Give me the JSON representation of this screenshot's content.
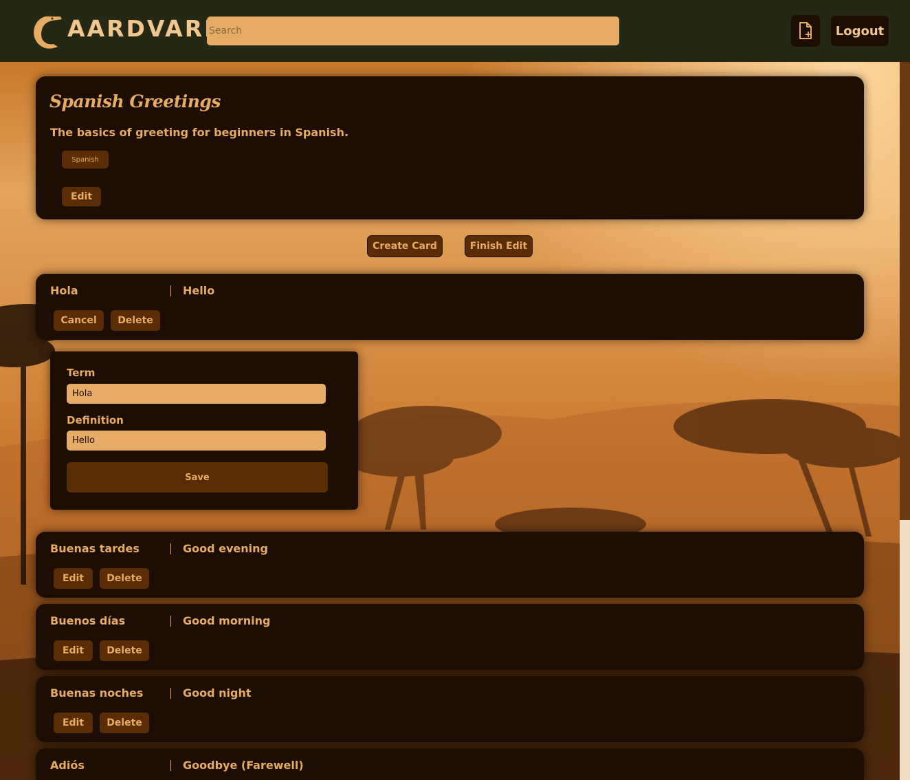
{
  "header": {
    "brand": "AARDVARK",
    "search_placeholder": "Search",
    "new_deck_icon": "file-plus-icon",
    "logout_label": "Logout"
  },
  "deck": {
    "title": "Spanish Greetings",
    "description": "The basics of greeting for beginners in Spanish.",
    "tag": "Spanish",
    "edit_label": "Edit"
  },
  "actions": {
    "create_card": "Create Card",
    "finish_edit": "Finish Edit"
  },
  "editing_card": {
    "term": "Hola",
    "definition": "Hello",
    "cancel_label": "Cancel",
    "delete_label": "Delete"
  },
  "editor": {
    "term_label": "Term",
    "term_value": "Hola",
    "definition_label": "Definition",
    "definition_value": "Hello",
    "save_label": "Save"
  },
  "cards": [
    {
      "term": "Buenas tardes",
      "definition": "Good evening",
      "edit_label": "Edit",
      "delete_label": "Delete"
    },
    {
      "term": "Buenos días",
      "definition": "Good morning",
      "edit_label": "Edit",
      "delete_label": "Delete"
    },
    {
      "term": "Buenas noches",
      "definition": "Good night",
      "edit_label": "Edit",
      "delete_label": "Delete"
    },
    {
      "term": "Adiós",
      "definition": "Goodbye (Farewell)"
    }
  ],
  "colors": {
    "header_bg": "#262816",
    "panel_bg": "#1c0e04",
    "accent": "#e8ab62",
    "button_bg": "#5a2d07",
    "input_bg": "#e6ab64"
  }
}
